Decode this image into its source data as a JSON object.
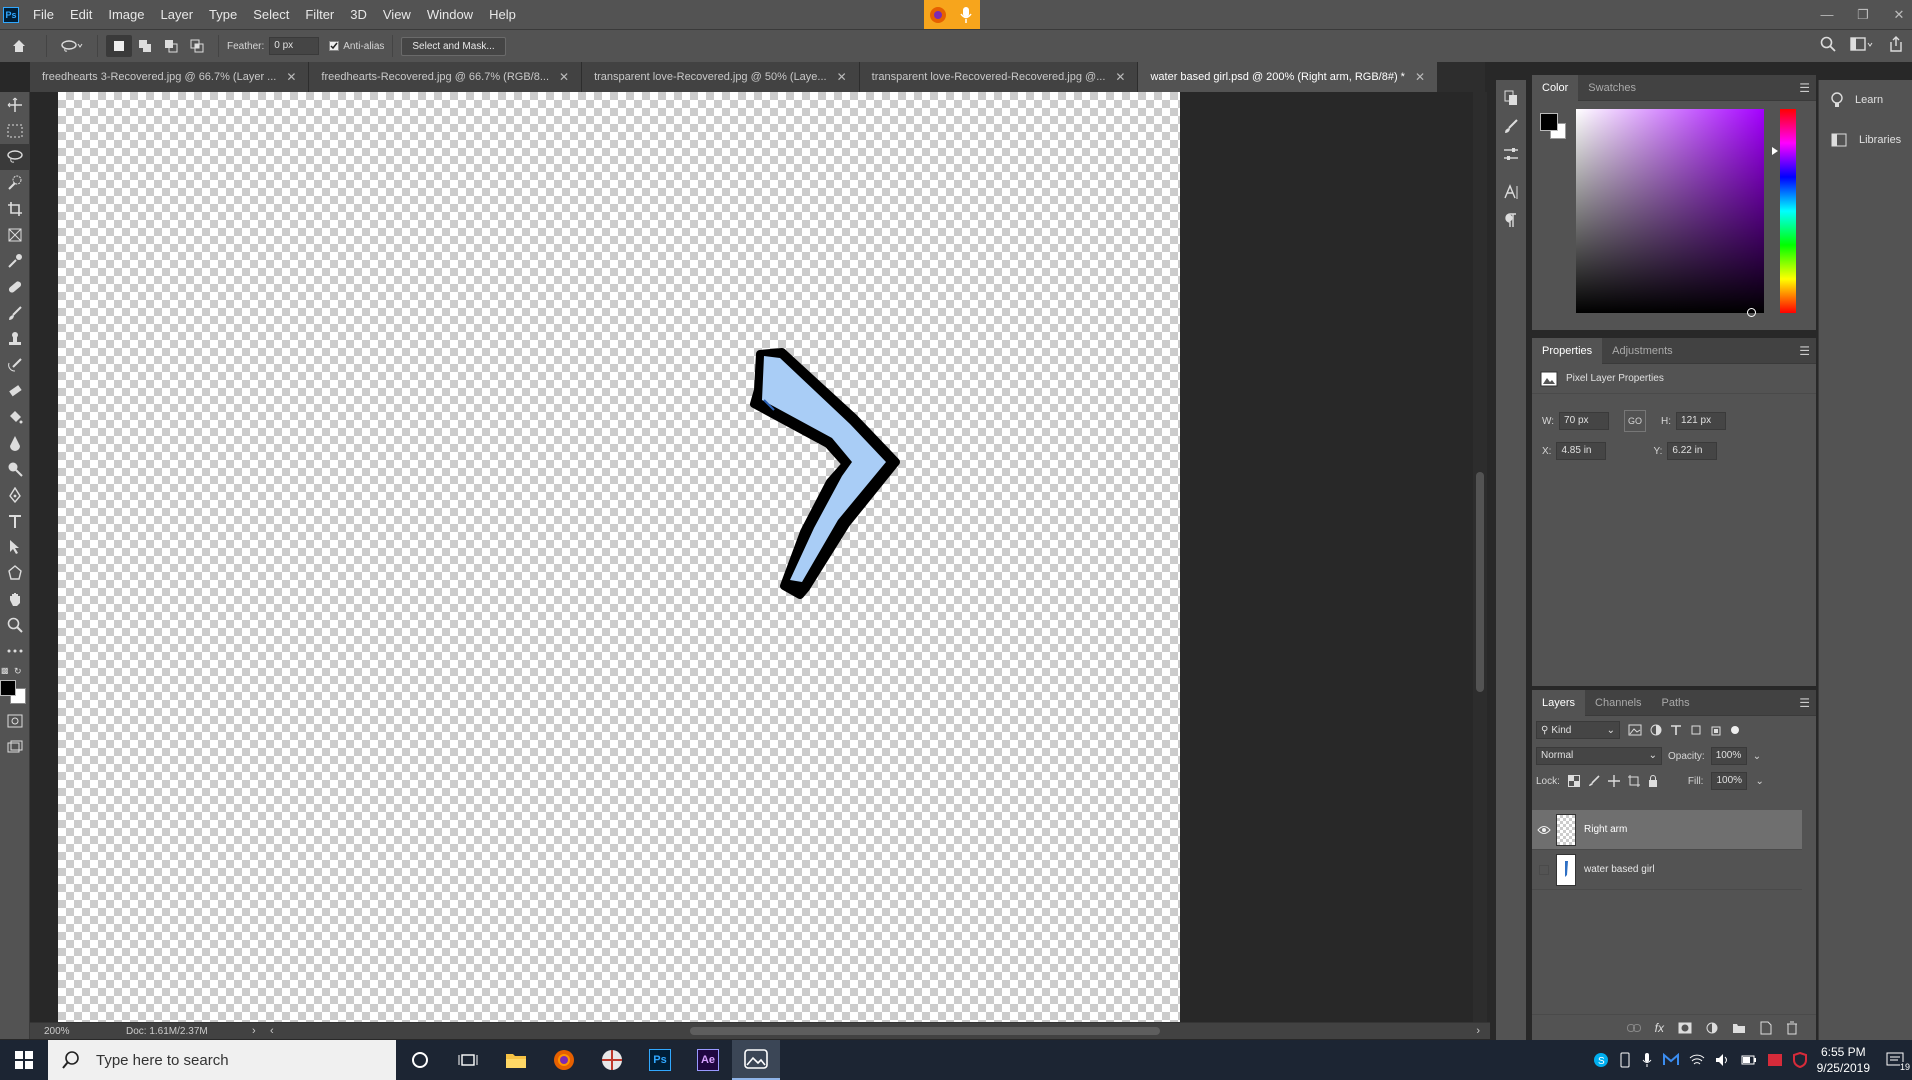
{
  "menubar": {
    "logo": "Ps",
    "items": [
      "File",
      "Edit",
      "Image",
      "Layer",
      "Type",
      "Select",
      "Filter",
      "3D",
      "View",
      "Window",
      "Help"
    ]
  },
  "options": {
    "feather_label": "Feather:",
    "feather_value": "0 px",
    "antialias_label": "Anti-alias",
    "select_mask_label": "Select and Mask..."
  },
  "tabs": [
    {
      "label": "freedhearts 3-Recovered.jpg @ 66.7% (Layer ..."
    },
    {
      "label": "freedhearts-Recovered.jpg @ 66.7% (RGB/8..."
    },
    {
      "label": "transparent love-Recovered.jpg @ 50% (Laye..."
    },
    {
      "label": "transparent love-Recovered-Recovered.jpg @..."
    },
    {
      "label": "water based girl.psd @ 200% (Right arm, RGB/8#) *"
    }
  ],
  "status": {
    "zoom": "200%",
    "doc": "Doc: 1.61M/2.37M"
  },
  "color_panel": {
    "tabs": [
      "Color",
      "Swatches"
    ]
  },
  "learn_panel": {
    "learn": "Learn",
    "libraries": "Libraries"
  },
  "properties": {
    "tabs": [
      "Properties",
      "Adjustments"
    ],
    "header": "Pixel Layer Properties",
    "w_label": "W:",
    "w_value": "70 px",
    "h_label": "H:",
    "h_value": "121 px",
    "link_label": "GO",
    "x_label": "X:",
    "x_value": "4.85 in",
    "y_label": "Y:",
    "y_value": "6.22 in"
  },
  "layers_panel": {
    "tabs": [
      "Layers",
      "Channels",
      "Paths"
    ],
    "kind": "Kind",
    "blend_mode": "Normal",
    "opacity_label": "Opacity:",
    "opacity_value": "100%",
    "lock_label": "Lock:",
    "fill_label": "Fill:",
    "fill_value": "100%",
    "layers": [
      {
        "name": "Right arm"
      },
      {
        "name": "water based girl"
      }
    ],
    "footer_fx": "fx"
  },
  "taskbar": {
    "search_placeholder": "Type here to search",
    "time": "6:55 PM",
    "date": "9/25/2019",
    "notif_count": "19"
  },
  "colors": {
    "ps_blue": "#31a8ff",
    "arm_fill": "#a9cdf6",
    "taskbar": "#1c2533"
  }
}
